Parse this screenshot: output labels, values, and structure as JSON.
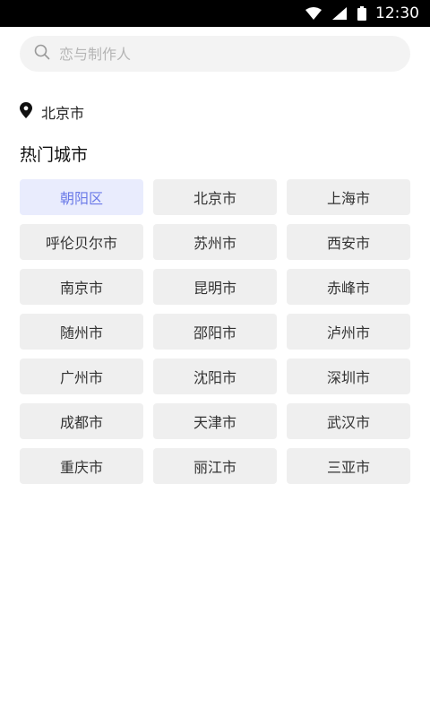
{
  "status_bar": {
    "time": "12:30",
    "icons": [
      "wifi-icon",
      "signal-icon",
      "battery-icon"
    ]
  },
  "search": {
    "placeholder": "恋与制作人",
    "icon": "search-icon"
  },
  "location": {
    "icon": "location-pin-icon",
    "current_city": "北京市"
  },
  "hot_cities": {
    "title": "热门城市",
    "selected": "朝阳区",
    "selected_color": "#6b7ae8",
    "items": [
      "朝阳区",
      "北京市",
      "上海市",
      "呼伦贝尔市",
      "苏州市",
      "西安市",
      "南京市",
      "昆明市",
      "赤峰市",
      "随州市",
      "邵阳市",
      "泸州市",
      "广州市",
      "沈阳市",
      "深圳市",
      "成都市",
      "天津市",
      "武汉市",
      "重庆市",
      "丽江市",
      "三亚市"
    ]
  }
}
